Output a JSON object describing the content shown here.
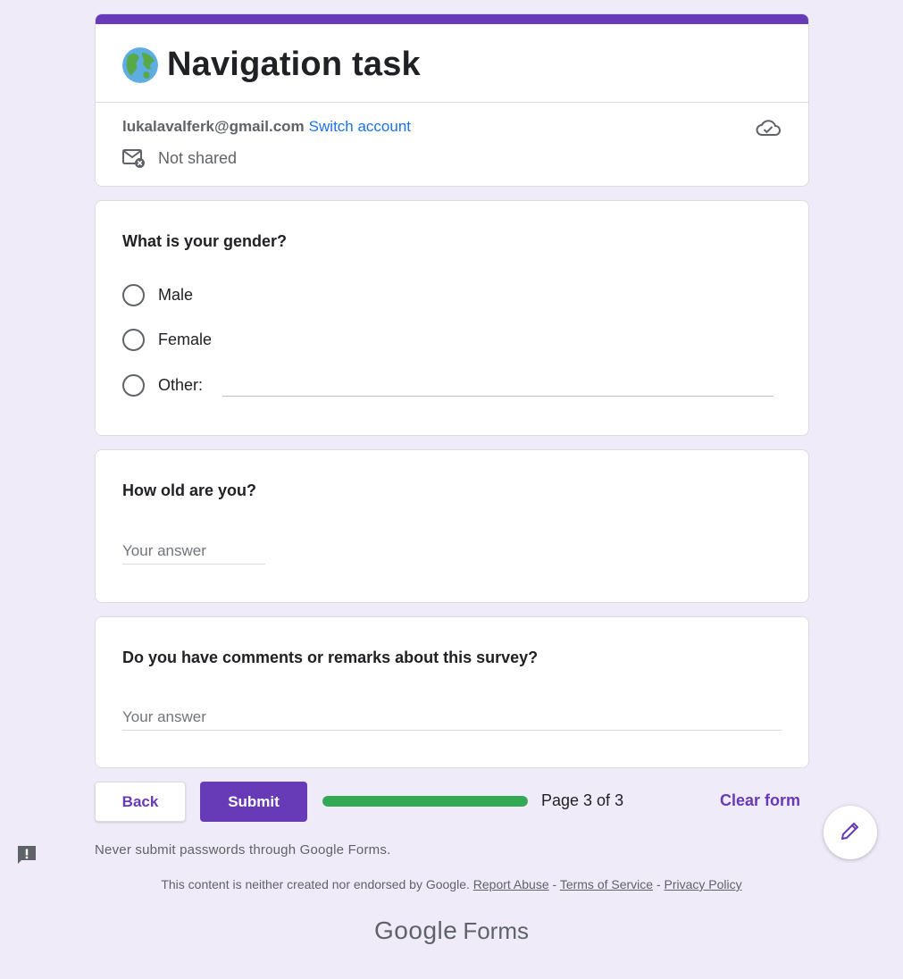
{
  "header": {
    "title": "Navigation task",
    "email": "lukalavalferk@gmail.com",
    "switch_account": "Switch account",
    "not_shared": "Not shared"
  },
  "questions": {
    "gender": {
      "title": "What is your gender?",
      "options": [
        "Male",
        "Female",
        "Other:"
      ]
    },
    "age": {
      "title": "How old are you?",
      "placeholder": "Your answer"
    },
    "comments": {
      "title": "Do you have comments or remarks about this survey?",
      "placeholder": "Your answer"
    }
  },
  "nav": {
    "back": "Back",
    "submit": "Submit",
    "progress_fraction": 1.0,
    "page_indicator": "Page 3 of 3",
    "clear_form": "Clear form"
  },
  "notice": "Never submit passwords through Google Forms.",
  "footer": {
    "disclaimer": "This content is neither created nor endorsed by Google.",
    "report_abuse": "Report Abuse",
    "sep1": "-",
    "terms": "Terms of Service",
    "sep2": "-",
    "privacy": "Privacy Policy"
  },
  "logo": {
    "google": "Google",
    "forms": "Forms"
  },
  "colors": {
    "accent": "#673ab7",
    "background": "#f0ebf8",
    "progress": "#34a853",
    "link": "#1a73e8"
  },
  "icons": {
    "globe": "globe-icon",
    "cloud": "cloud-check-icon",
    "mail": "mail-not-shared-icon",
    "report": "report-problem-icon",
    "edit": "pencil-icon"
  }
}
